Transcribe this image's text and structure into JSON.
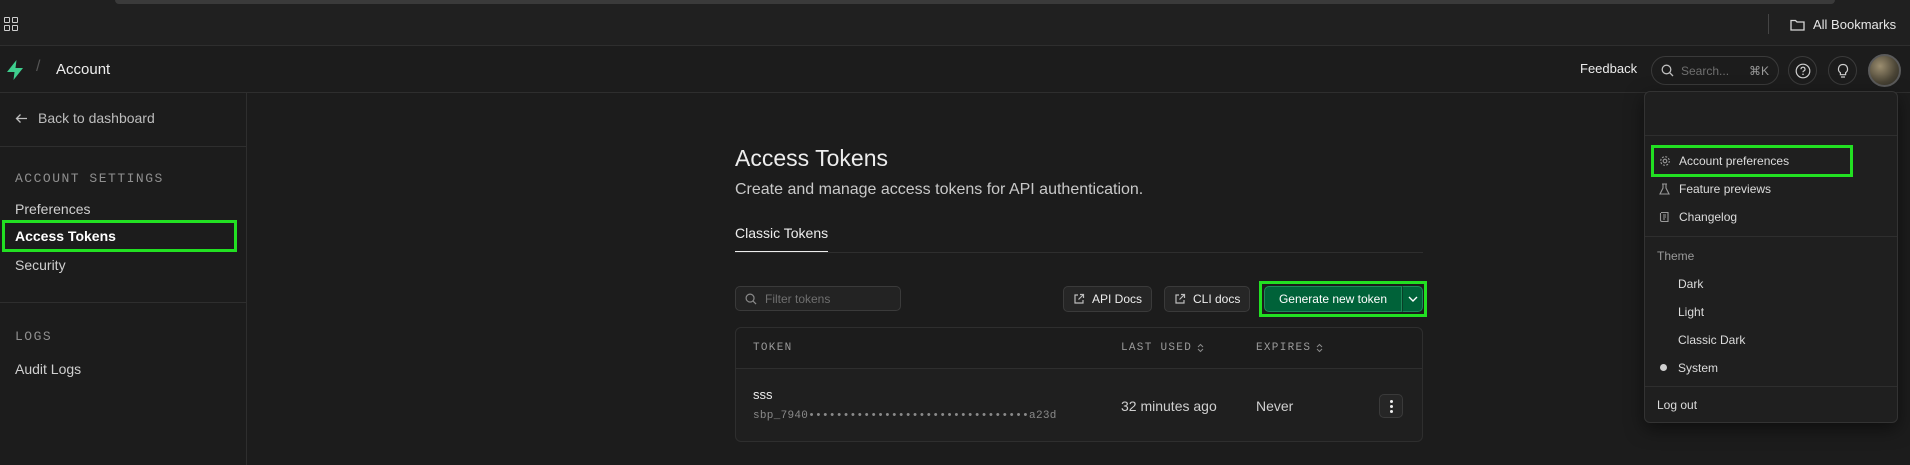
{
  "browser": {
    "all_bookmarks_label": "All Bookmarks"
  },
  "header": {
    "breadcrumb": "Account",
    "feedback_label": "Feedback",
    "search_placeholder": "Search...",
    "search_shortcut": "⌘K"
  },
  "sidebar": {
    "back_label": "Back to dashboard",
    "account_settings_heading": "ACCOUNT SETTINGS",
    "items": [
      {
        "label": "Preferences"
      },
      {
        "label": "Access Tokens",
        "selected": true
      },
      {
        "label": "Security"
      }
    ],
    "logs_heading": "LOGS",
    "logs_items": [
      {
        "label": "Audit Logs"
      }
    ]
  },
  "main": {
    "title": "Access Tokens",
    "subtitle": "Create and manage access tokens for API authentication.",
    "tab": "Classic Tokens",
    "filter_placeholder": "Filter tokens",
    "api_docs_label": "API Docs",
    "cli_docs_label": "CLI docs",
    "generate_label": "Generate new token",
    "table": {
      "headers": [
        "TOKEN",
        "LAST USED",
        "EXPIRES"
      ],
      "rows": [
        {
          "name": "sss",
          "value": "sbp_7940••••••••••••••••••••••••••••••••a23d",
          "last_used": "32 minutes ago",
          "expires": "Never"
        }
      ]
    }
  },
  "menu": {
    "items": [
      {
        "label": "Account preferences",
        "icon": "gear-icon"
      },
      {
        "label": "Feature previews",
        "icon": "flask-icon"
      },
      {
        "label": "Changelog",
        "icon": "scroll-icon"
      }
    ],
    "theme_label": "Theme",
    "themes": [
      "Dark",
      "Light",
      "Classic Dark",
      "System"
    ],
    "selected_theme": "System",
    "logout_label": "Log out"
  },
  "colors": {
    "background": "#1c1c1c",
    "brand_green": "#3ecf8e",
    "primary_button": "#006239",
    "highlight": "#22e022"
  }
}
